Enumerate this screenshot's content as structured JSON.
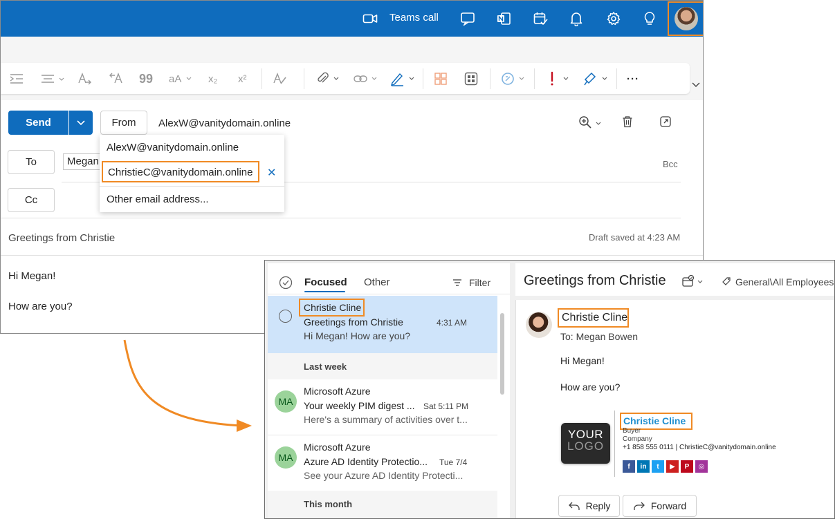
{
  "colors": {
    "brand": "#0f6cbd",
    "highlight": "#f08a24",
    "selected_row": "#cfe4fa"
  },
  "topbar": {
    "teams_call_label": "Teams call",
    "icons": [
      "video-icon",
      "chat-icon",
      "onenote-icon",
      "calendar-check-icon",
      "bell-icon",
      "gear-icon",
      "lightbulb-icon"
    ]
  },
  "ribbon": {
    "icons": [
      "indent-icon",
      "align-icon",
      "text-direction-icon",
      "rtl-icon",
      "quote-icon",
      "font-case-icon",
      "subscript-icon",
      "superscript-icon",
      "styles-icon",
      "attach-icon",
      "link-icon",
      "signature-icon",
      "apps-icon",
      "grid-icon",
      "copilot-icon",
      "importance-icon",
      "format-painter-icon",
      "more-icon"
    ],
    "subscript_label": "x₂",
    "superscript_label": "x²",
    "font_case_label": "aA",
    "quote_label": "99",
    "more_label": "···"
  },
  "compose": {
    "send_label": "Send",
    "from_label": "From",
    "from_address": "AlexW@vanitydomain.online",
    "to_label": "To",
    "cc_label": "Cc",
    "to_partial": "Megan",
    "bcc_label": "Bcc",
    "subject": "Greetings from Christie",
    "draft_status": "Draft saved at 4:23 AM",
    "body_line1": "Hi Megan!",
    "body_line2": "How are you?"
  },
  "from_menu": {
    "options": [
      "AlexW@vanitydomain.online",
      "ChristieC@vanitydomain.online"
    ],
    "other_label": "Other email address...",
    "remove_glyph": "✕"
  },
  "inbox": {
    "tabs": {
      "focused": "Focused",
      "other": "Other"
    },
    "filter_label": "Filter",
    "selected_item": {
      "sender": "Christie Cline",
      "subject": "Greetings from Christie",
      "time": "4:31 AM",
      "preview": "Hi Megan! How are you?"
    },
    "groups": [
      "Last week",
      "This month"
    ],
    "items": [
      {
        "initials": "MA",
        "sender": "Microsoft Azure",
        "subject": "Your weekly PIM digest ...",
        "time": "Sat 5:11 PM",
        "preview": "Here's a summary of activities over t..."
      },
      {
        "initials": "MA",
        "sender": "Microsoft Azure",
        "subject": "Azure AD Identity Protectio...",
        "time": "Tue 7/4",
        "preview": "See your Azure AD Identity Protecti..."
      }
    ]
  },
  "reading": {
    "title": "Greetings from Christie",
    "category": "General\\All Employees",
    "sender": "Christie Cline",
    "to_line": "To:  Megan Bowen",
    "body_line1": "Hi Megan!",
    "body_line2": "How are you?",
    "logo_line1": "YOUR",
    "logo_line2": "LOGO",
    "signature": {
      "name": "Christie Cline",
      "role": "Buyer",
      "company": "Company",
      "contact": "+1 858 555 0111 | ChristieC@vanitydomain.online"
    },
    "socials": [
      {
        "label": "f",
        "color": "#3b5998",
        "icon": "facebook-icon"
      },
      {
        "label": "in",
        "color": "#0077b5",
        "icon": "linkedin-icon"
      },
      {
        "label": "t",
        "color": "#1da1f2",
        "icon": "twitter-icon"
      },
      {
        "label": "▶",
        "color": "#cd201f",
        "icon": "youtube-icon"
      },
      {
        "label": "P",
        "color": "#bd081c",
        "icon": "pinterest-icon"
      },
      {
        "label": "◎",
        "color": "#a2349a",
        "icon": "instagram-icon"
      }
    ],
    "reply_label": "Reply",
    "forward_label": "Forward"
  }
}
